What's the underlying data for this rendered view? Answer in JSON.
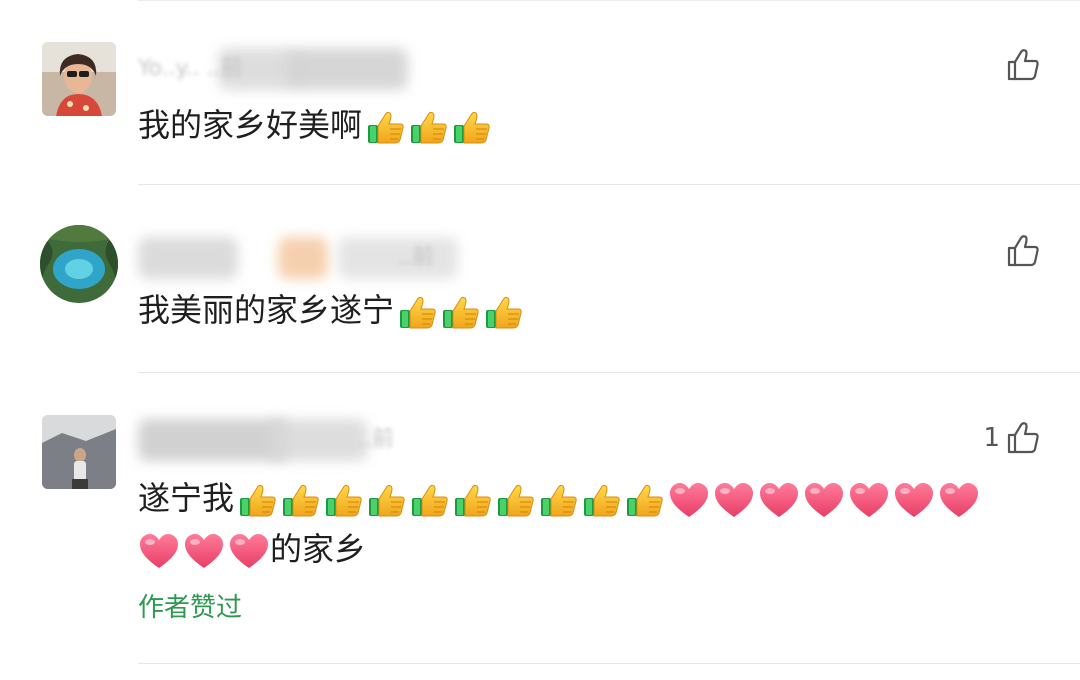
{
  "comments": [
    {
      "name_hint": "Yo..y.. ..前",
      "text": "我的家乡好美啊",
      "emojis": [
        "thumbs-up",
        "thumbs-up",
        "thumbs-up"
      ],
      "like_count": ""
    },
    {
      "name_hint": "..前",
      "text": "我美丽的家乡遂宁",
      "emojis": [
        "thumbs-up",
        "thumbs-up",
        "thumbs-up"
      ],
      "like_count": ""
    },
    {
      "name_hint": "..前",
      "text_prefix": "遂宁我",
      "line1_emojis": [
        "thumbs-up",
        "thumbs-up",
        "thumbs-up",
        "thumbs-up",
        "thumbs-up",
        "thumbs-up",
        "thumbs-up",
        "thumbs-up",
        "thumbs-up",
        "thumbs-up",
        "heart",
        "heart",
        "heart",
        "heart",
        "heart",
        "heart",
        "heart"
      ],
      "line2_emojis": [
        "heart",
        "heart",
        "heart"
      ],
      "text_suffix": "的家乡",
      "like_count": "1",
      "author_liked": "作者赞过"
    }
  ],
  "colors": {
    "author_liked": "#2e9a4f",
    "divider": "#e6e6e6",
    "text": "#1f1f1f"
  },
  "icons": {
    "like": "thumbs-up-outline-icon",
    "emoji_thumb": "thumbs-up-emoji",
    "emoji_heart": "heart-emoji"
  }
}
